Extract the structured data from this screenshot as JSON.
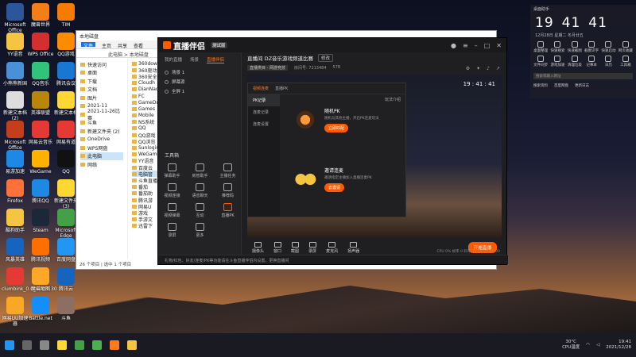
{
  "desktop": {
    "icons": [
      {
        "label": "Microsoft Office Wo...",
        "color": "#2b579a"
      },
      {
        "label": "YY语音",
        "color": "#f5c542"
      },
      {
        "label": "小熊熊新国",
        "color": "#4a90d9"
      },
      {
        "label": "新建文本档 (2)",
        "color": "#ddd"
      },
      {
        "label": "Microsoft Office Wo...",
        "color": "#c43e1c"
      },
      {
        "label": "易游加速",
        "color": "#1e88e5"
      },
      {
        "label": "Firefox",
        "color": "#ff7139"
      },
      {
        "label": "酷狗助手",
        "color": "#f5c542"
      },
      {
        "label": "风暴英雄",
        "color": "#1565c0"
      },
      {
        "label": "clumbink_0.0_6723130",
        "color": "#e53935"
      },
      {
        "label": "网易UU加速器",
        "color": "#f9a825"
      },
      {
        "label": "魔兽世界",
        "color": "#f57f17"
      },
      {
        "label": "WPS Office",
        "color": "#d32f2f"
      },
      {
        "label": "QQ音乐",
        "color": "#31c27c"
      },
      {
        "label": "英雄联盟",
        "color": "#b8860b"
      },
      {
        "label": "网易云音乐",
        "color": "#e53935"
      },
      {
        "label": "WeGame",
        "color": "#ffb300"
      },
      {
        "label": "腾讯QQ",
        "color": "#1e88e5"
      },
      {
        "label": "Steam",
        "color": "#1b2838"
      },
      {
        "label": "腾讯视频",
        "color": "#ff6f00"
      },
      {
        "label": "魔兽地图",
        "color": "#ffa726"
      },
      {
        "label": "Battle.net",
        "color": "#148eff"
      },
      {
        "label": "TIM",
        "color": "#f57c00"
      },
      {
        "label": "QQ游戏",
        "color": "#fb8c00"
      },
      {
        "label": "腾讯会议",
        "color": "#1976d2"
      },
      {
        "label": "新建文本档",
        "color": "#fdd835"
      },
      {
        "label": "网易有道",
        "color": "#e53935"
      },
      {
        "label": "QQ",
        "color": "#111"
      },
      {
        "label": "新建文件夹 (3)",
        "color": "#fdd835"
      },
      {
        "label": "Microsoft Edge",
        "color": "#43a047"
      },
      {
        "label": "百度网盘",
        "color": "#2196f3"
      },
      {
        "label": "腾讯云",
        "color": "#1565c0"
      },
      {
        "label": "斗鱼",
        "color": "#8d6e63"
      }
    ]
  },
  "explorer": {
    "title": "本地磁盘",
    "ribbon": [
      "文件",
      "主页",
      "共享",
      "查看"
    ],
    "address": "此电脑 > 本地磁盘",
    "nav": [
      "快速访问",
      "桌面",
      "下载",
      "文档",
      "图片",
      "2021-11",
      "2021-11-26比赛",
      "斗鱼",
      "新建文件夹 (2)",
      "OneDrive",
      "WPS网盘",
      "此电脑",
      "网络"
    ],
    "nav_selected": 11,
    "files": [
      "360dow",
      "360驱动",
      "360安全",
      "Cloudh",
      "DianNao",
      "FC",
      "GameDo",
      "Games",
      "Mobile",
      "NS系统",
      "QQ",
      "QQ游戏",
      "QQ浏览",
      "Sunlogin",
      "WeGame",
      "YY语音",
      "百度云",
      "电脑管",
      "斗鱼直播",
      "番茄",
      "番茄助",
      "腾讯游",
      "网易U",
      "游戏",
      "手游文",
      "迅雷下"
    ],
    "files_selected": 17,
    "status": "26 个项目 | 选中 1 个项目"
  },
  "app": {
    "name": "直播伴侣",
    "version": "测试版",
    "side_tabs": [
      "我的直播",
      "场景",
      "直播伴侣"
    ],
    "side_tab_active": 2,
    "scenes": [
      "场景 1",
      "屏幕源",
      "全屏 1"
    ],
    "toolbox_title": "工具箱",
    "tools": [
      {
        "label": "弹幕助手"
      },
      {
        "label": "房管助手"
      },
      {
        "label": "主播任务"
      },
      {
        "label": "视频连接"
      },
      {
        "label": "语音聊天"
      },
      {
        "label": "推荐码"
      },
      {
        "label": "视频弹幕"
      },
      {
        "label": "互动"
      },
      {
        "label": "直播PK",
        "hot": true
      },
      {
        "label": "录屏"
      },
      {
        "label": "更多"
      }
    ],
    "footer_notice": "礼物/红包、好友/连麦/PK等功能请在斗鱼直播伴侣内设置，更换直播间",
    "room_title": "直播间 DZ音乐游戏频道比赛",
    "room_edit": "修改",
    "room_category": "直播类目 - 网游竞技",
    "room_id_label": "房间号: 7213484",
    "room_hot": "578",
    "popup": {
      "tabs": [
        "视频连麦",
        "直播PK"
      ],
      "tab_active": 0,
      "left_items": [
        "PK记录",
        "连麦记录",
        "连麦设置"
      ],
      "left_active": 0,
      "rules": "玩法介绍",
      "features": [
        {
          "name": "随机PK",
          "desc": "随机与其他主播，开启PK连麦玩法",
          "button": "立即匹配",
          "kind": "single"
        },
        {
          "name": "邀请连麦",
          "desc": "邀请指定主播加入直播连麦PK",
          "button": "去邀请",
          "kind": "duo"
        }
      ]
    },
    "preview_clock": "19 : 41 : 41",
    "controls": [
      "摄像头",
      "窗口",
      "截图",
      "录屏",
      "麦克风",
      "扬声器"
    ],
    "start_button": "开始直播",
    "stats": "CPU 0% 帧率 0 码率 0kbps 00:00:00"
  },
  "widget": {
    "header": "桌面助手",
    "hour": "19",
    "minute": "41",
    "second": "41",
    "date": "12月28日 星期二 冬月廿五",
    "grid": [
      "桌面整理",
      "快速搜索",
      "快速截图",
      "截图识字",
      "快速启动",
      "网页收藏",
      "文件同步",
      "游戏加速",
      "清理垃圾",
      "记事本",
      "日历",
      "工具箱"
    ],
    "search_placeholder": "搜索或输入网址",
    "links": [
      "搜索资料",
      "百度网盘",
      "更新日志"
    ]
  },
  "taskbar": {
    "apps": [
      {
        "name": "windows-start",
        "color": "#2196f3"
      },
      {
        "name": "search",
        "color": "#666"
      },
      {
        "name": "task-view",
        "color": "#888"
      },
      {
        "name": "file-explorer",
        "color": "#fdd835"
      },
      {
        "name": "edge",
        "color": "#43a047"
      },
      {
        "name": "wechat",
        "color": "#4caf50"
      },
      {
        "name": "douyu",
        "color": "#ff7a1a"
      },
      {
        "name": "live-companion",
        "color": "#f5c542"
      }
    ],
    "temp": "30°C",
    "cpu_label": "CPU温度",
    "time": "19:41",
    "date": "2021/12/28"
  }
}
